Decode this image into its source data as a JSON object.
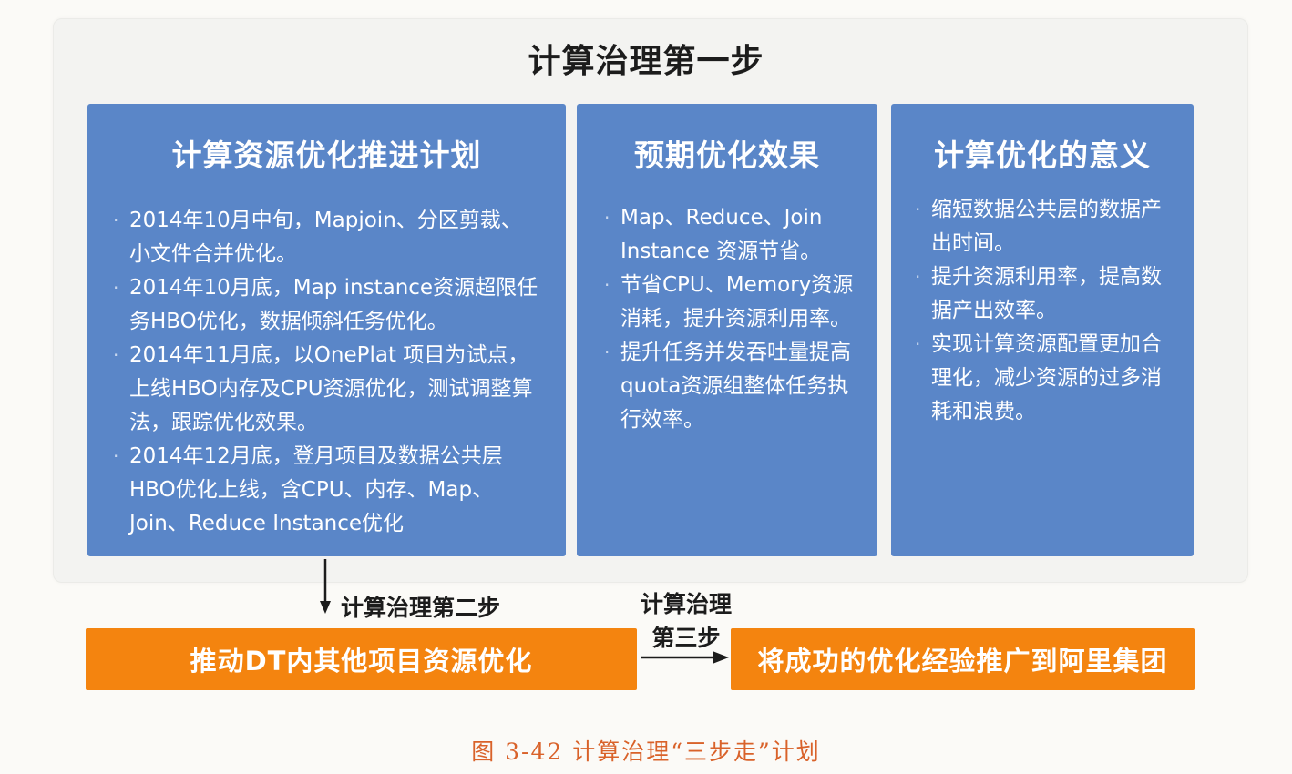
{
  "title": "计算治理第一步",
  "panels": [
    {
      "title": "计算资源优化推进计划",
      "items": [
        "2014年10月中旬，Mapjoin、分区剪裁、小文件合并优化。",
        "2014年10月底，Map instance资源超限任务HBO优化，数据倾斜任务优化。",
        "2014年11月底，以OnePlat 项目为试点，上线HBO内存及CPU资源优化，测试调整算法，跟踪优化效果。",
        "2014年12月底，登月项目及数据公共层HBO优化上线，含CPU、内存、Map、Join、Reduce Instance优化"
      ]
    },
    {
      "title": "预期优化效果",
      "items": [
        "Map、Reduce、Join Instance 资源节省。",
        "节省CPU、Memory资源消耗，提升资源利用率。",
        "提升任务并发吞吐量提高quota资源组整体任务执行效率。"
      ]
    },
    {
      "title": "计算优化的意义",
      "items": [
        "缩短数据公共层的数据产出时间。",
        "提升资源利用率，提高数据产出效率。",
        "实现计算资源配置更加合理化，减少资源的过多消耗和浪费。"
      ]
    }
  ],
  "step2": {
    "label": "计算治理第二步",
    "box": "推动DT内其他项目资源优化"
  },
  "step3": {
    "label_line1": "计算治理",
    "label_line2": "第三步",
    "box": "将成功的优化经验推广到阿里集团"
  },
  "caption": "图 3-42 计算治理“三步走”计划",
  "colors": {
    "panel_blue": "#5a86c8",
    "step_orange": "#f4840f",
    "caption_red": "#d9622a"
  }
}
